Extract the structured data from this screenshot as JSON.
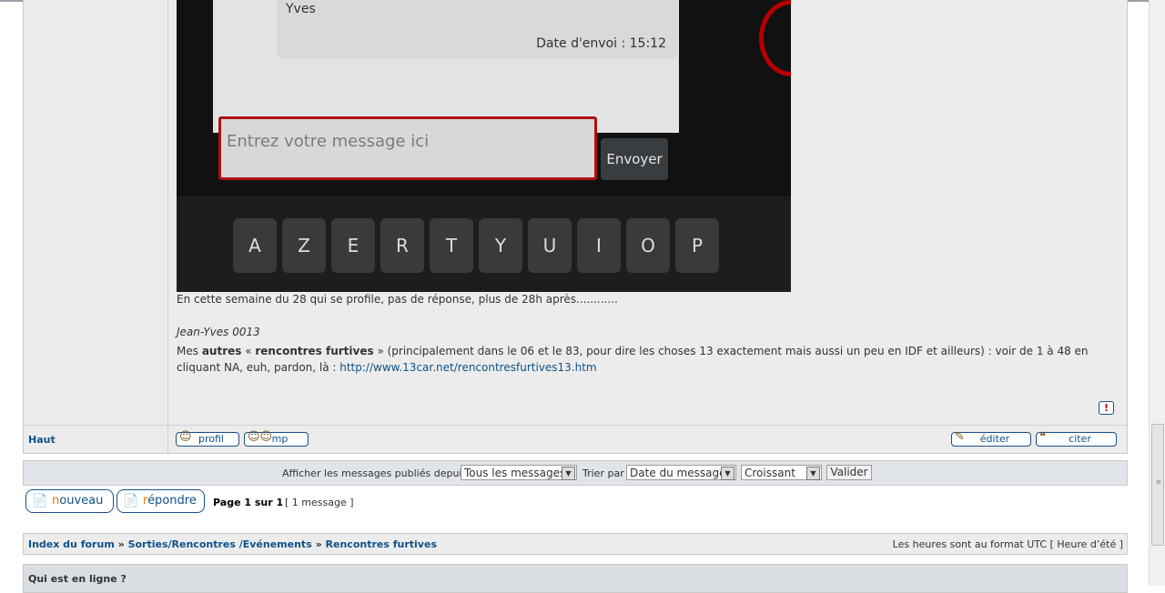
{
  "post": {
    "image": {
      "bubble_name": "Yves",
      "bubble_time": "Date d'envoi : 15:12",
      "input_placeholder": "Entrez votre message ici",
      "send_label": "Envoyer",
      "keys": [
        "A",
        "Z",
        "E",
        "R",
        "T",
        "Y",
        "U",
        "I",
        "O",
        "P"
      ]
    },
    "text_line": "En cette semaine du 28 qui se profile, pas de réponse, plus de 28h après............",
    "signature": "Jean-Yves 0013",
    "mes_prefix": "Mes ",
    "mes_bold1": "autres",
    "mes_quote_open": " « ",
    "mes_bold2": "rencontres furtives",
    "mes_rest": " » (principalement dans le 06 et le 83, pour dire les choses 13 exactement mais aussi un peu en IDF et ailleurs) : voir de 1 à 48 en cliquant NA, euh, pardon, là : ",
    "mes_link": "http://www.13car.net/rencontresfurtives13.htm",
    "report_label": "!"
  },
  "actions": {
    "haut": "Haut",
    "profil": "profil",
    "mp": "mp",
    "editer": "éditer",
    "citer": "citer"
  },
  "sort": {
    "label1": "Afficher les messages publiés depuis :",
    "select1": "Tous les messages",
    "label2": "Trier par",
    "select2": "Date du message",
    "select3": "Croissant",
    "submit": "Valider"
  },
  "buttons": {
    "nouveau_first": "n",
    "nouveau_rest": "ouveau",
    "repondre_first": "r",
    "repondre_rest": "épondre"
  },
  "pagination": {
    "page": "Page 1 sur 1",
    "count": "[ 1 message ]"
  },
  "breadcrumb": {
    "index": "Index du forum",
    "cat": "Sorties/Rencontres /Evénements",
    "forum": "Rencontres furtives",
    "sep": "»",
    "timezone": "Les heures sont au format UTC [ Heure d’été ]"
  },
  "online": {
    "title": "Qui est en ligne ?"
  }
}
